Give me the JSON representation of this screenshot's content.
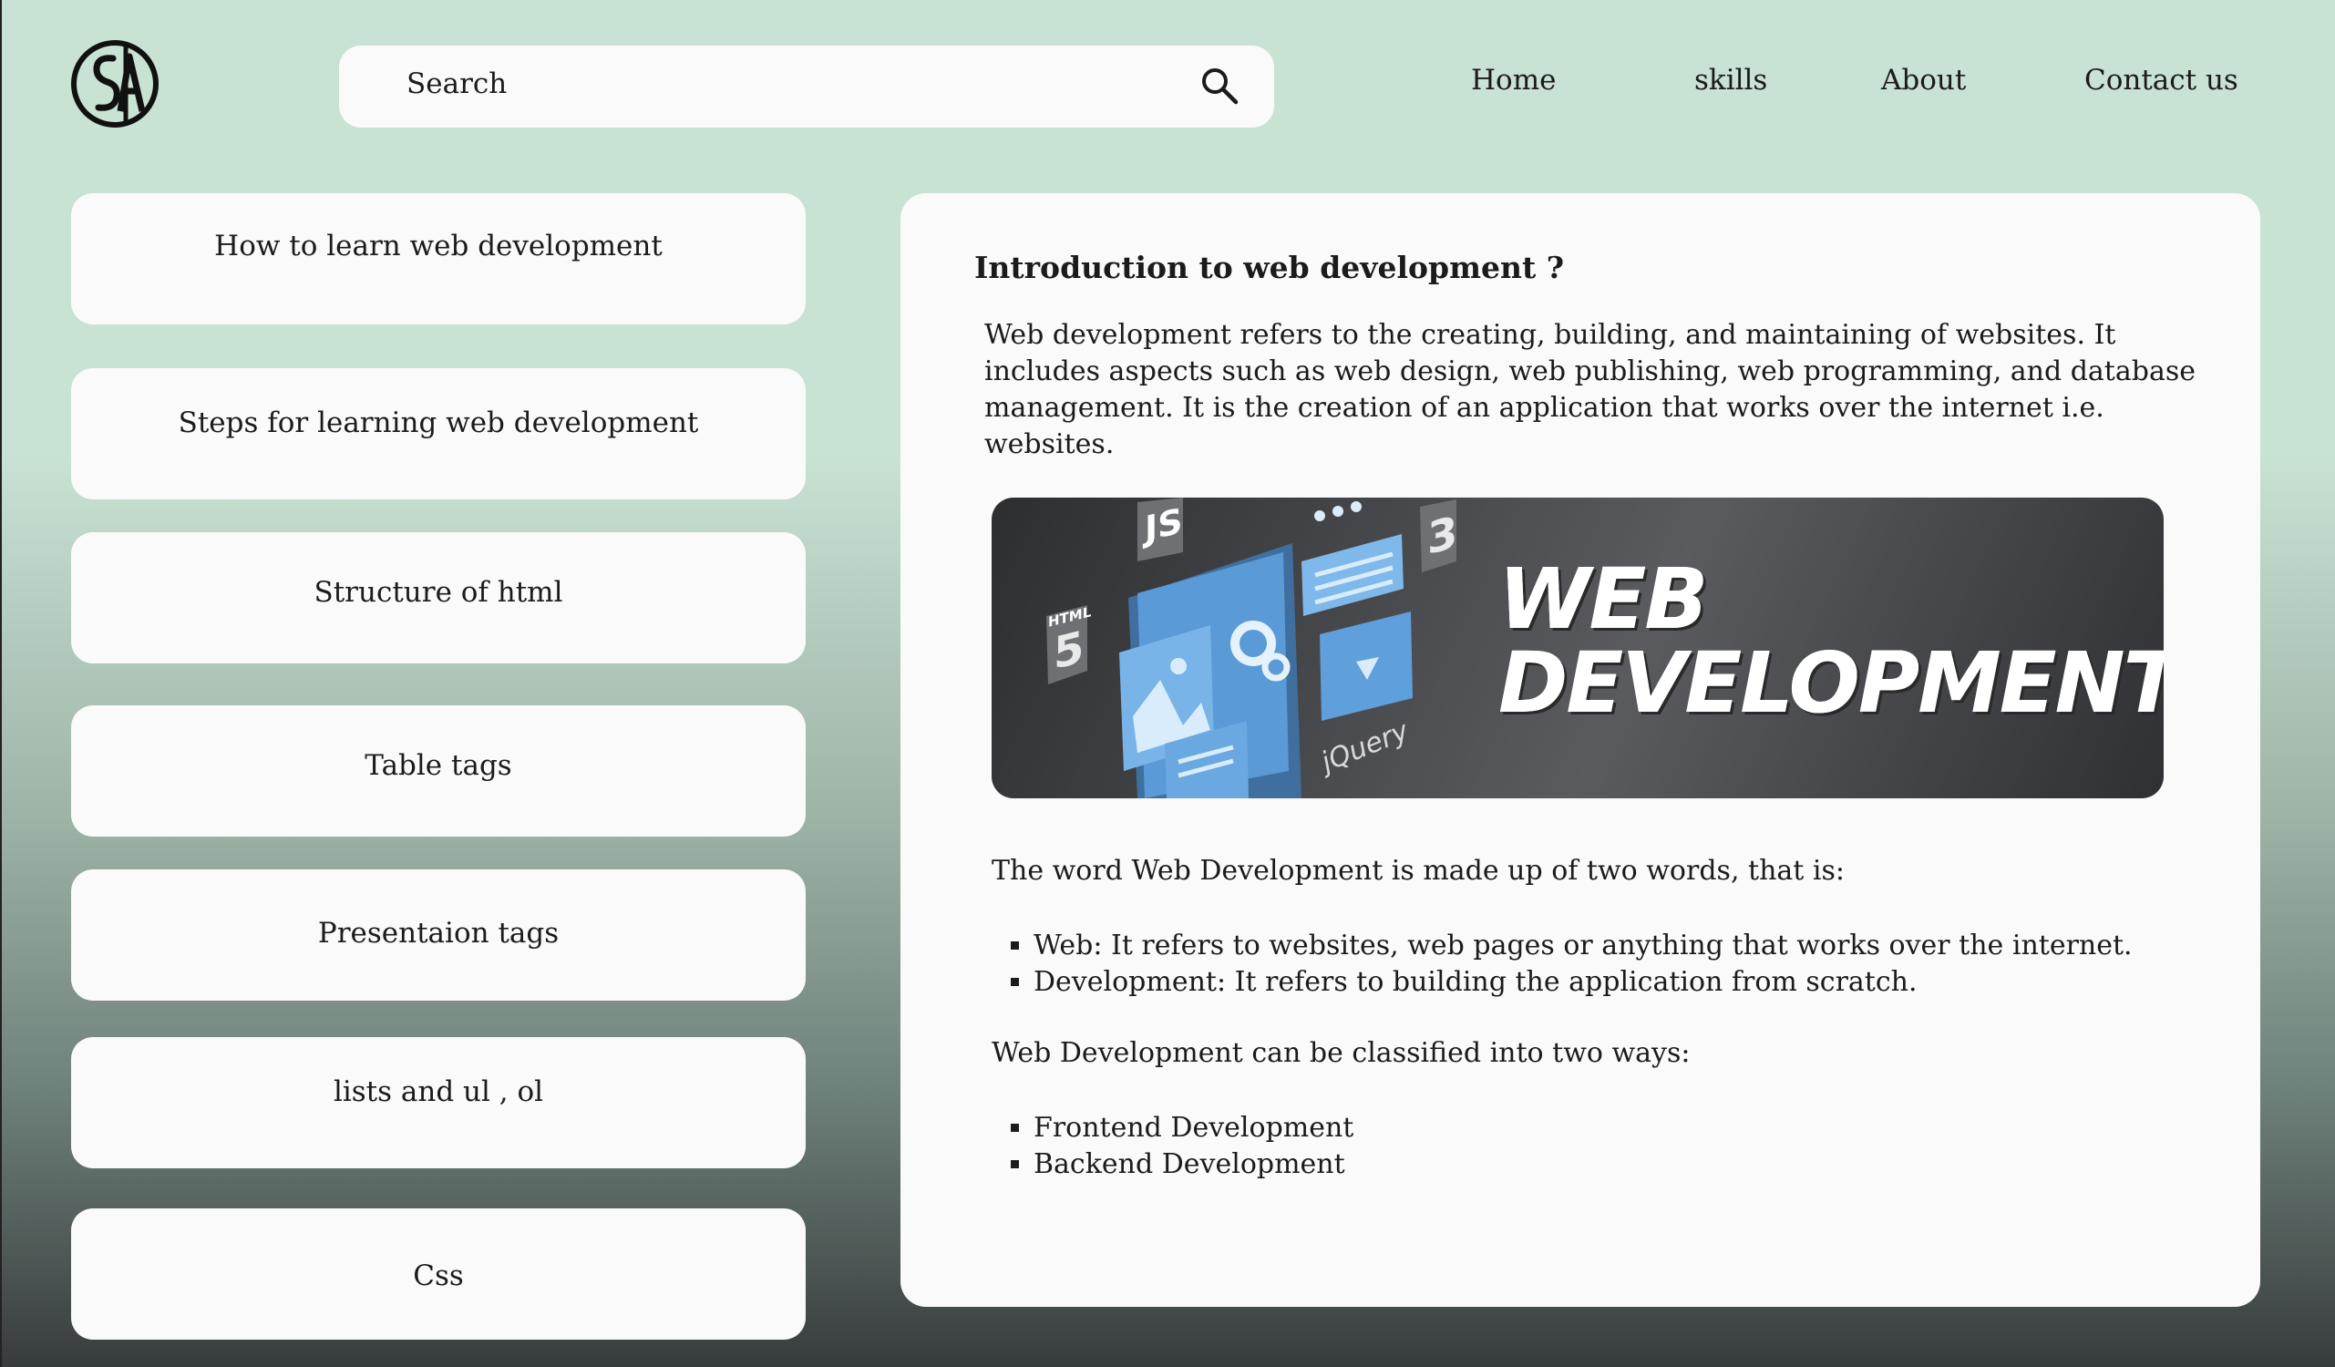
{
  "header": {
    "search_placeholder": "Search",
    "nav": [
      "Home",
      "skills",
      "About",
      "Contact us"
    ]
  },
  "sidebar": {
    "items": [
      "How to learn web development",
      "Steps for learning web development",
      "Structure of html",
      "Table tags",
      "Presentaion tags",
      "lists and ul , ol",
      "Css"
    ]
  },
  "main": {
    "title": "Introduction to web development ?",
    "intro": "Web development refers to the creating, building, and maintaining of websites. It includes aspects such as web design, web publishing, web programming, and database management. It is the creation of an application that works over the internet i.e. websites.",
    "banner": {
      "line1": "WEB",
      "line2": "DEVELOPMENT",
      "labels": [
        "JS",
        "HTML",
        "5",
        "3",
        "jQuery"
      ]
    },
    "para1": "The word Web Development is made up of two words, that is:",
    "list1": [
      "Web: It refers to websites, web pages or anything that works over the internet.",
      "Development: It refers to building the application from scratch."
    ],
    "para2": "Web Development can be classified into two ways:",
    "list2": [
      "Frontend Development",
      "Backend Development"
    ]
  },
  "colors": {
    "bg_top": "#c8e2d4",
    "bg_bottom": "#373c3c",
    "card": "#fafafa",
    "banner_blue": "#4a8fd4"
  }
}
